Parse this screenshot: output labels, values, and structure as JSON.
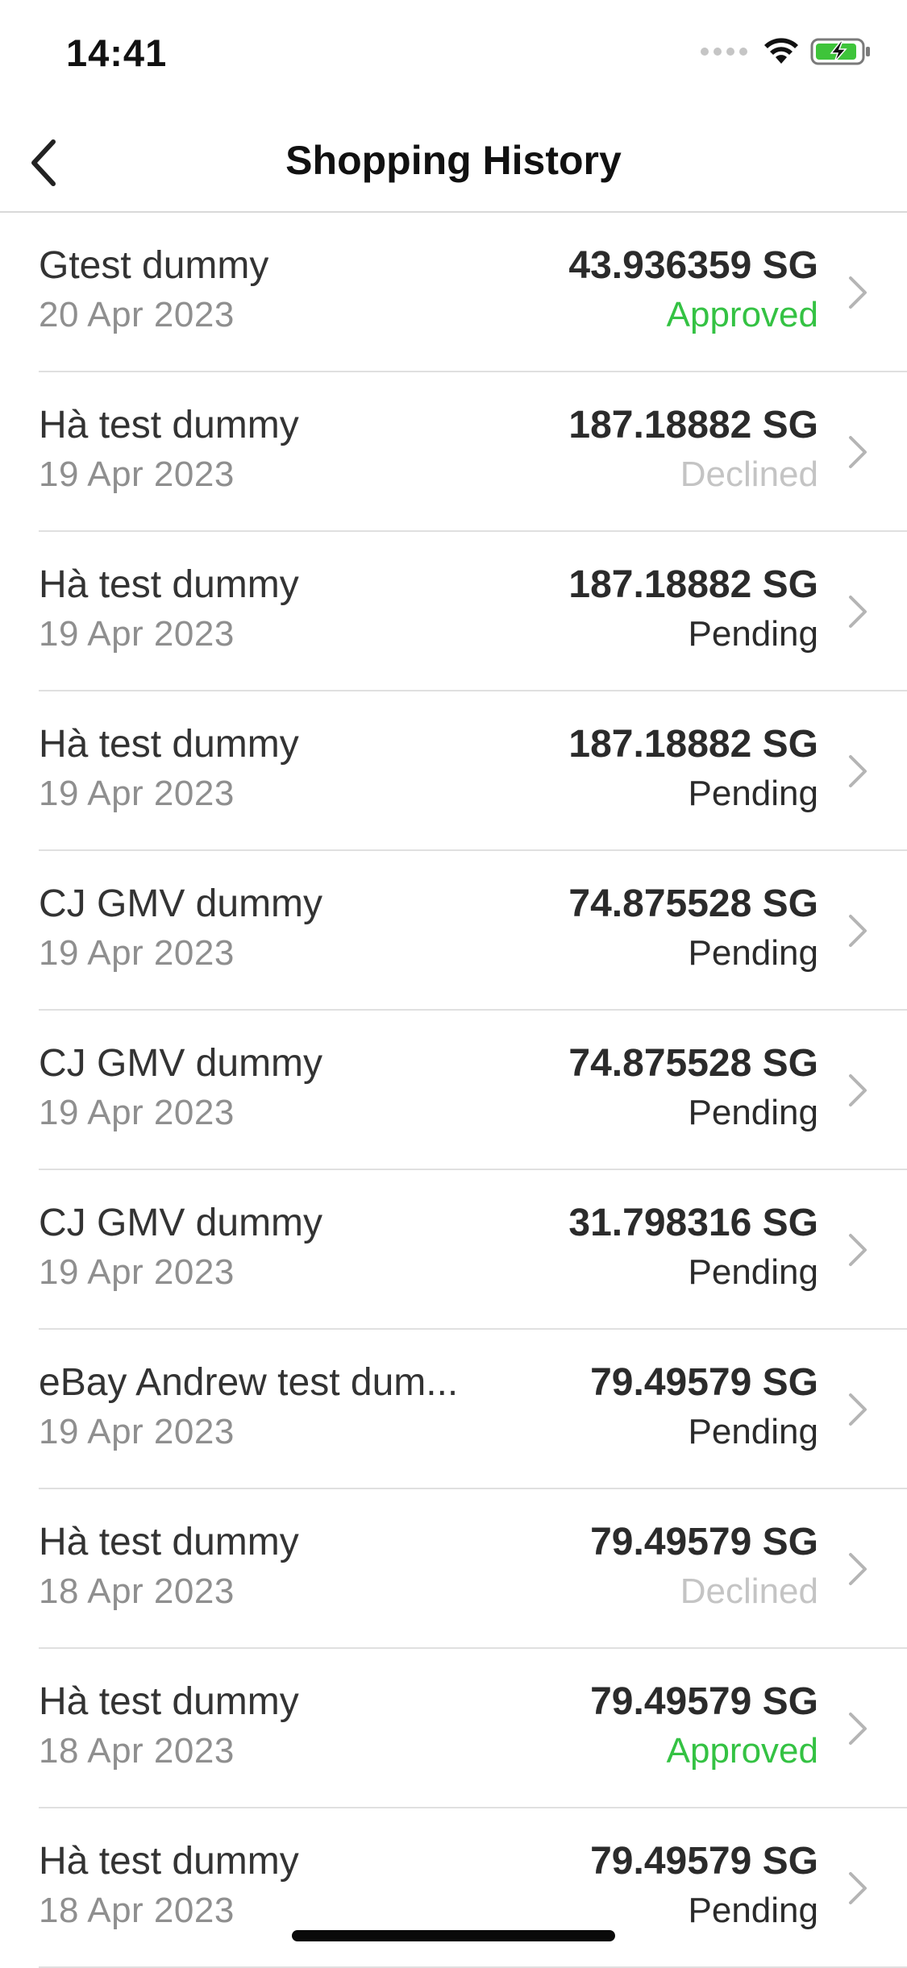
{
  "status_bar": {
    "time": "14:41"
  },
  "nav": {
    "title": "Shopping History",
    "back_icon": "chevron-left-icon"
  },
  "colors": {
    "approved": "#34c243",
    "declined": "#c4c4c4",
    "pending": "#2b2b2b",
    "battery": "#3ec43a"
  },
  "transactions": [
    {
      "name": "Gtest dummy",
      "date": "20 Apr 2023",
      "amount": "43.936359 SG",
      "status": "Approved",
      "status_type": "approved"
    },
    {
      "name": "Hà test dummy",
      "date": "19 Apr 2023",
      "amount": "187.18882 SG",
      "status": "Declined",
      "status_type": "declined"
    },
    {
      "name": "Hà test dummy",
      "date": "19 Apr 2023",
      "amount": "187.18882 SG",
      "status": "Pending",
      "status_type": "pending"
    },
    {
      "name": "Hà test dummy",
      "date": "19 Apr 2023",
      "amount": "187.18882 SG",
      "status": "Pending",
      "status_type": "pending"
    },
    {
      "name": "CJ GMV dummy",
      "date": "19 Apr 2023",
      "amount": "74.875528 SG",
      "status": "Pending",
      "status_type": "pending"
    },
    {
      "name": "CJ GMV dummy",
      "date": "19 Apr 2023",
      "amount": "74.875528 SG",
      "status": "Pending",
      "status_type": "pending"
    },
    {
      "name": "CJ GMV dummy",
      "date": "19 Apr 2023",
      "amount": "31.798316 SG",
      "status": "Pending",
      "status_type": "pending"
    },
    {
      "name": "eBay Andrew test dum...",
      "date": "19 Apr 2023",
      "amount": "79.49579 SG",
      "status": "Pending",
      "status_type": "pending"
    },
    {
      "name": "Hà test dummy",
      "date": "18 Apr 2023",
      "amount": "79.49579 SG",
      "status": "Declined",
      "status_type": "declined"
    },
    {
      "name": "Hà test dummy",
      "date": "18 Apr 2023",
      "amount": "79.49579 SG",
      "status": "Approved",
      "status_type": "approved"
    },
    {
      "name": "Hà test dummy",
      "date": "18 Apr 2023",
      "amount": "79.49579 SG",
      "status": "Pending",
      "status_type": "pending"
    }
  ]
}
